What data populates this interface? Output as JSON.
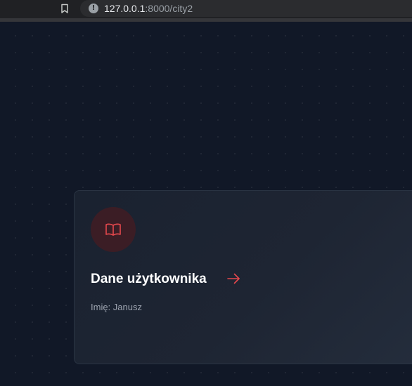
{
  "browser": {
    "url_host": "127.0.0.1",
    "url_rest": ":8000/city2"
  },
  "card": {
    "title": "Dane użytkownika",
    "text": "Imię: Janusz"
  },
  "colors": {
    "accent": "#e5484d",
    "background": "#111827",
    "card_background": "#1e2533",
    "icon_circle": "#3b1d25"
  },
  "icons": {
    "card_icon": "book-open-icon",
    "link_icon": "arrow-right-icon"
  }
}
